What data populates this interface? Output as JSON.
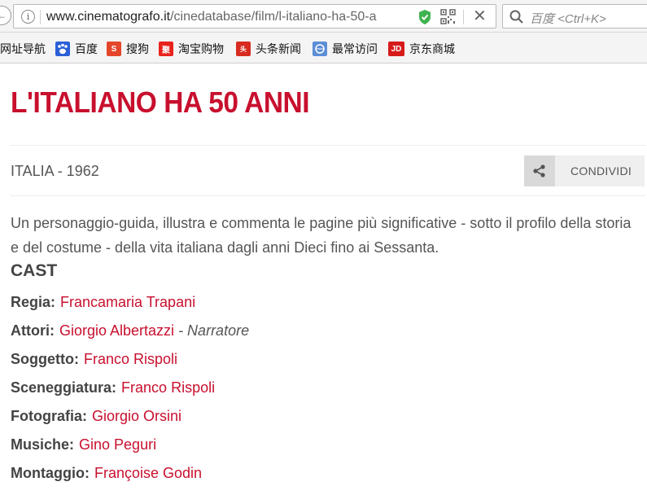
{
  "browser": {
    "url_host": "www.cinematografo.it",
    "url_path": "/cinedatabase/film/l-italiano-ha-50-a",
    "search_placeholder": "百度 <Ctrl+K>"
  },
  "bookmarks": [
    {
      "label": "网址导航",
      "icon": "none"
    },
    {
      "label": "百度",
      "icon": "baidu-paw-icon"
    },
    {
      "label": "搜狗",
      "icon": "sogou-icon"
    },
    {
      "label": "淘宝购物",
      "icon": "taobao-icon"
    },
    {
      "label": "头条新闻",
      "icon": "toutiao-icon"
    },
    {
      "label": "最常访问",
      "icon": "globe-icon"
    },
    {
      "label": "京东商城",
      "icon": "jd-icon"
    }
  ],
  "film": {
    "title": "L'ITALIANO HA 50 ANNI",
    "meta": "ITALIA - 1962",
    "share_label": "CONDIVIDI",
    "synopsis": "Un personaggio-guida, illustra e commenta le pagine più significative - sotto il profilo della storia e del costume - della vita italiana dagli anni Dieci fino ai Sessanta.",
    "cast_heading": "CAST",
    "credits": [
      {
        "role": "Regia:",
        "person": "Francamaria Trapani",
        "note": ""
      },
      {
        "role": "Attori:",
        "person": "Giorgio Albertazzi",
        "note": " - Narratore"
      },
      {
        "role": "Soggetto:",
        "person": "Franco Rispoli",
        "note": ""
      },
      {
        "role": "Sceneggiatura:",
        "person": "Franco Rispoli",
        "note": ""
      },
      {
        "role": "Fotografia:",
        "person": "Giorgio Orsini",
        "note": ""
      },
      {
        "role": "Musiche:",
        "person": "Gino Peguri",
        "note": ""
      },
      {
        "role": "Montaggio:",
        "person": "Françoise Godin",
        "note": ""
      }
    ]
  },
  "colors": {
    "accent": "#c8102e",
    "text": "#555555"
  }
}
